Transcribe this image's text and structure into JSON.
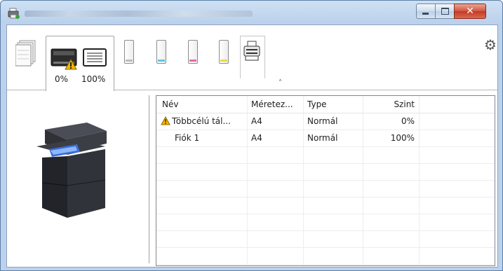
{
  "icons": {
    "app": "printer-app-icon",
    "minimize": "minimize-icon",
    "maximize": "maximize-icon",
    "close": "close-icon",
    "paper": "paper-stack-icon",
    "tray1": "tray-icon",
    "tray2": "tray-icon",
    "warning": "warning-icon",
    "toner_k": "toner-cartridge-icon",
    "toner_c": "toner-cartridge-icon",
    "toner_m": "toner-cartridge-icon",
    "toner_y": "toner-cartridge-icon",
    "device": "printer-device-icon",
    "settings": "gear-icon",
    "collapse": "chevron-up-icon"
  },
  "window": {
    "close_glyph": "✕"
  },
  "toolbar": {
    "tray1_level": "0%",
    "tray2_level": "100%",
    "toner_colors": [
      "#bdbdbd",
      "#5ac8e8",
      "#e86aa6",
      "#e8d94a"
    ],
    "warning_color": "#f2b600"
  },
  "table": {
    "columns": [
      "Név",
      "Méretez...",
      "Type",
      "Szint"
    ],
    "rows": [
      {
        "name": "Többcélú tál...",
        "size": "A4",
        "type": "Normál",
        "level": "0%",
        "warning": true
      },
      {
        "name": "Fiók 1",
        "size": "A4",
        "type": "Normál",
        "level": "100%",
        "warning": false
      }
    ],
    "empty_rows": 7
  }
}
